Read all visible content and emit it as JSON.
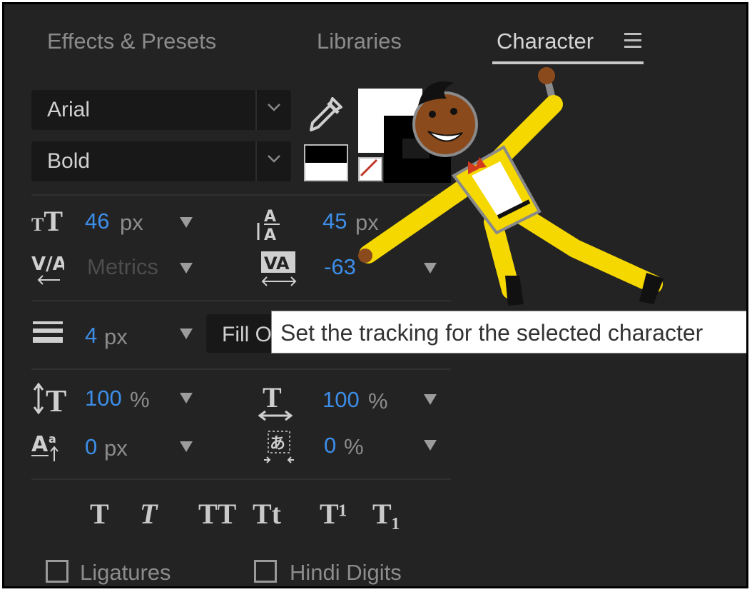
{
  "tabs": [
    {
      "label": "Effects & Presets"
    },
    {
      "label": "Libraries"
    },
    {
      "label": "Character"
    }
  ],
  "font": {
    "family": "Arial",
    "style": "Bold"
  },
  "metrics": {
    "font_size": {
      "value": "46",
      "unit": "px"
    },
    "leading": {
      "value": "45",
      "unit": "px"
    },
    "kerning": {
      "value": "Metrics"
    },
    "tracking": {
      "value": "-63"
    },
    "stroke_width": {
      "value": "4",
      "unit": "px"
    },
    "stroke_mode": "Fill O",
    "vertical_scale": {
      "value": "100",
      "unit": "%"
    },
    "horizontal_scale": {
      "value": "100",
      "unit": "%"
    },
    "baseline_shift": {
      "value": "0",
      "unit": "px"
    },
    "tsume": {
      "value": "0",
      "unit": "%"
    }
  },
  "tooltip": "Set the tracking for the selected character",
  "style_buttons": [
    "T",
    "T",
    "TT",
    "Tt",
    "T¹",
    "T₁"
  ],
  "options": [
    {
      "label": "Ligatures",
      "checked": false
    },
    {
      "label": "Hindi Digits",
      "checked": false
    }
  ],
  "colors": {
    "panel": "#232323",
    "value_blue": "#3d8ee8",
    "character_suit": "#f5d800"
  }
}
